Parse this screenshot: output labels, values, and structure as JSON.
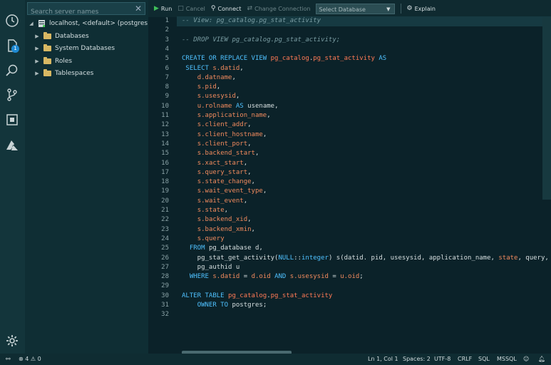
{
  "sidebar": {
    "search_placeholder": "Search server names",
    "server": "localhost, <default> (postgres)",
    "folders": [
      "Databases",
      "System Databases",
      "Roles",
      "Tablespaces"
    ]
  },
  "activity_badge": "1",
  "toolbar": {
    "run": "Run",
    "cancel": "Cancel",
    "connect": "Connect",
    "change_connection": "Change Connection",
    "select_database": "Select Database",
    "explain": "Explain"
  },
  "editor": {
    "line_numbers": [
      "1",
      "2",
      "3",
      "4",
      "5",
      "6",
      "7",
      "8",
      "9",
      "10",
      "11",
      "12",
      "13",
      "14",
      "15",
      "16",
      "17",
      "18",
      "19",
      "20",
      "21",
      "22",
      "23",
      "24",
      "25",
      "26",
      "27",
      "28",
      "29",
      "30",
      "31",
      "32"
    ],
    "lines": [
      [
        [
          "c-com",
          "-- View: pg_catalog.pg_stat_activity"
        ]
      ],
      [],
      [
        [
          "c-com",
          "-- DROP VIEW pg_catalog.pg_stat_activity;"
        ]
      ],
      [],
      [
        [
          "c-kw",
          "CREATE OR REPLACE VIEW "
        ],
        [
          "c-obj",
          "pg_catalog"
        ],
        [
          "c-plain",
          "."
        ],
        [
          "c-obj",
          "pg_stat_activity"
        ],
        [
          "c-kw",
          " AS"
        ]
      ],
      [
        [
          "c-plain",
          " "
        ],
        [
          "c-kw",
          "SELECT "
        ],
        [
          "c-fld",
          "s.datid"
        ],
        [
          "c-plain",
          ","
        ]
      ],
      [
        [
          "c-plain",
          "    "
        ],
        [
          "c-fld",
          "d.datname"
        ],
        [
          "c-plain",
          ","
        ]
      ],
      [
        [
          "c-plain",
          "    "
        ],
        [
          "c-fld",
          "s.pid"
        ],
        [
          "c-plain",
          ","
        ]
      ],
      [
        [
          "c-plain",
          "    "
        ],
        [
          "c-fld",
          "s.usesysid"
        ],
        [
          "c-plain",
          ","
        ]
      ],
      [
        [
          "c-plain",
          "    "
        ],
        [
          "c-fld",
          "u.rolname"
        ],
        [
          "c-kw",
          " AS"
        ],
        [
          "c-plain",
          " usename,"
        ]
      ],
      [
        [
          "c-plain",
          "    "
        ],
        [
          "c-fld",
          "s.application_name"
        ],
        [
          "c-plain",
          ","
        ]
      ],
      [
        [
          "c-plain",
          "    "
        ],
        [
          "c-fld",
          "s.client_addr"
        ],
        [
          "c-plain",
          ","
        ]
      ],
      [
        [
          "c-plain",
          "    "
        ],
        [
          "c-fld",
          "s.client_hostname"
        ],
        [
          "c-plain",
          ","
        ]
      ],
      [
        [
          "c-plain",
          "    "
        ],
        [
          "c-fld",
          "s.client_port"
        ],
        [
          "c-plain",
          ","
        ]
      ],
      [
        [
          "c-plain",
          "    "
        ],
        [
          "c-fld",
          "s.backend_start"
        ],
        [
          "c-plain",
          ","
        ]
      ],
      [
        [
          "c-plain",
          "    "
        ],
        [
          "c-fld",
          "s.xact_start"
        ],
        [
          "c-plain",
          ","
        ]
      ],
      [
        [
          "c-plain",
          "    "
        ],
        [
          "c-fld",
          "s.query_start"
        ],
        [
          "c-plain",
          ","
        ]
      ],
      [
        [
          "c-plain",
          "    "
        ],
        [
          "c-fld",
          "s.state_change"
        ],
        [
          "c-plain",
          ","
        ]
      ],
      [
        [
          "c-plain",
          "    "
        ],
        [
          "c-fld",
          "s.wait_event_type"
        ],
        [
          "c-plain",
          ","
        ]
      ],
      [
        [
          "c-plain",
          "    "
        ],
        [
          "c-fld",
          "s.wait_event"
        ],
        [
          "c-plain",
          ","
        ]
      ],
      [
        [
          "c-plain",
          "    "
        ],
        [
          "c-fld",
          "s.state"
        ],
        [
          "c-plain",
          ","
        ]
      ],
      [
        [
          "c-plain",
          "    "
        ],
        [
          "c-fld",
          "s.backend_xid"
        ],
        [
          "c-plain",
          ","
        ]
      ],
      [
        [
          "c-plain",
          "    "
        ],
        [
          "c-fld",
          "s.backend_xmin"
        ],
        [
          "c-plain",
          ","
        ]
      ],
      [
        [
          "c-plain",
          "    "
        ],
        [
          "c-fld",
          "s.query"
        ]
      ],
      [
        [
          "c-plain",
          "  "
        ],
        [
          "c-kw",
          "FROM "
        ],
        [
          "c-plain",
          "pg_database d,"
        ]
      ],
      [
        [
          "c-plain",
          "    pg_stat_get_activity("
        ],
        [
          "c-kw",
          "NULL"
        ],
        [
          "c-plain",
          "::"
        ],
        [
          "c-kw",
          "integer"
        ],
        [
          "c-plain",
          ") s(datid. pid, usesysid, application_name, "
        ],
        [
          "c-fld",
          "state"
        ],
        [
          "c-plain",
          ", query, wait_"
        ]
      ],
      [
        [
          "c-plain",
          "    pg_authid u"
        ]
      ],
      [
        [
          "c-plain",
          "  "
        ],
        [
          "c-kw",
          "WHERE "
        ],
        [
          "c-fld",
          "s.datid"
        ],
        [
          "c-plain",
          " = "
        ],
        [
          "c-fld",
          "d.oid"
        ],
        [
          "c-kw",
          " AND "
        ],
        [
          "c-fld",
          "s.usesysid"
        ],
        [
          "c-plain",
          " = "
        ],
        [
          "c-fld",
          "u.oid"
        ],
        [
          "c-plain",
          ";"
        ]
      ],
      [],
      [
        [
          "c-kw",
          "ALTER TABLE "
        ],
        [
          "c-obj",
          "pg_catalog"
        ],
        [
          "c-plain",
          "."
        ],
        [
          "c-obj",
          "pg_stat_activity"
        ]
      ],
      [
        [
          "c-plain",
          "    "
        ],
        [
          "c-kw",
          "OWNER TO"
        ],
        [
          "c-plain",
          " postgres;"
        ]
      ],
      []
    ]
  },
  "statusbar": {
    "problems_errors": "4",
    "problems_warnings": "0",
    "position": "Ln 1, Col 1",
    "spaces": "Spaces: 2",
    "encoding": "UTF-8",
    "eol": "CRLF",
    "language": "SQL",
    "provider": "MSSQL"
  },
  "colors": {
    "keyword": "#4fc1ff",
    "object": "#ff7a55",
    "comment": "#7a9da3",
    "background": "#0b2229"
  }
}
